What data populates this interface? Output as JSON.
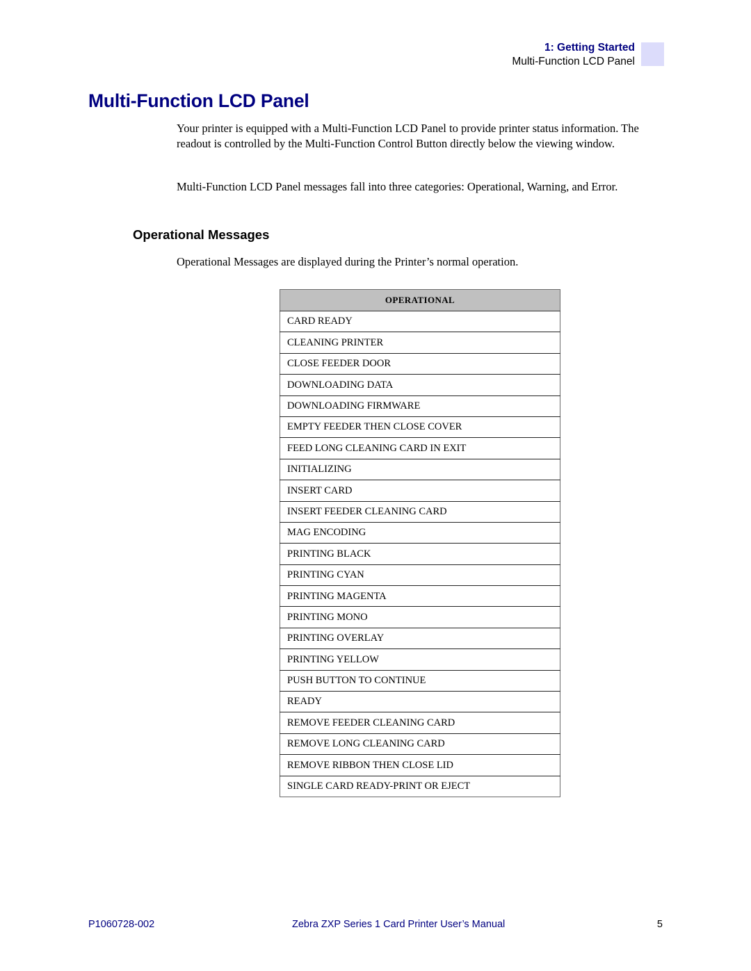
{
  "running_header": {
    "chapter": "1: Getting Started",
    "section": "Multi-Function LCD Panel",
    "tab_color": "#dcdcfb"
  },
  "page_title": "Multi-Function LCD Panel",
  "paragraphs": [
    "Your printer is equipped with a Multi-Function LCD Panel to provide printer status information. The readout is controlled by the Multi-Function Control Button directly below the viewing window.",
    "Multi-Function LCD Panel messages fall into three categories: Operational, Warning, and Error."
  ],
  "section": {
    "heading": "Operational Messages",
    "intro": "Operational Messages are displayed during the Printer’s normal operation."
  },
  "table": {
    "header": "OPERATIONAL",
    "rows": [
      "CARD READY",
      "CLEANING PRINTER",
      "CLOSE FEEDER DOOR",
      "DOWNLOADING DATA",
      "DOWNLOADING FIRMWARE",
      "EMPTY FEEDER THEN CLOSE COVER",
      "FEED LONG CLEANING CARD IN EXIT",
      "INITIALIZING",
      "INSERT CARD",
      "INSERT FEEDER CLEANING CARD",
      "MAG ENCODING",
      "PRINTING BLACK",
      "PRINTING CYAN",
      "PRINTING MAGENTA",
      "PRINTING MONO",
      "PRINTING OVERLAY",
      "PRINTING YELLOW",
      "PUSH BUTTON TO CONTINUE",
      "READY",
      "REMOVE FEEDER CLEANING CARD",
      "REMOVE LONG CLEANING CARD",
      "REMOVE RIBBON THEN CLOSE LID",
      "SINGLE CARD READY-PRINT OR EJECT"
    ]
  },
  "footer": {
    "doc_number": "P1060728-002",
    "manual_title": "Zebra ZXP Series 1 Card Printer User’s Manual",
    "page_number": "5"
  },
  "colors": {
    "title_blue": "#000080",
    "table_header_bg": "#c0c0c0"
  }
}
